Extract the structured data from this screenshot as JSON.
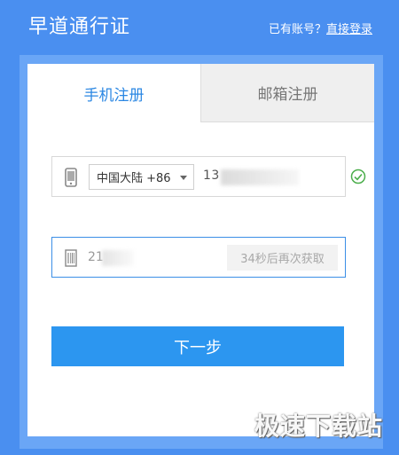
{
  "header": {
    "brand": "早道通行证",
    "login_prompt": "已有账号？",
    "login_link": "直接登录"
  },
  "tabs": [
    {
      "label": "手机注册",
      "active": true
    },
    {
      "label": "邮箱注册",
      "active": false
    }
  ],
  "phone": {
    "region": "中国大陆 +86",
    "value": "13"
  },
  "code": {
    "value": "21",
    "resend_label": "34秒后再次获取"
  },
  "actions": {
    "next_label": "下一步"
  },
  "watermark": "极速下载站",
  "colors": {
    "background": "#4a8ff0",
    "accent": "#2c96f0",
    "success": "#4cae4c"
  }
}
